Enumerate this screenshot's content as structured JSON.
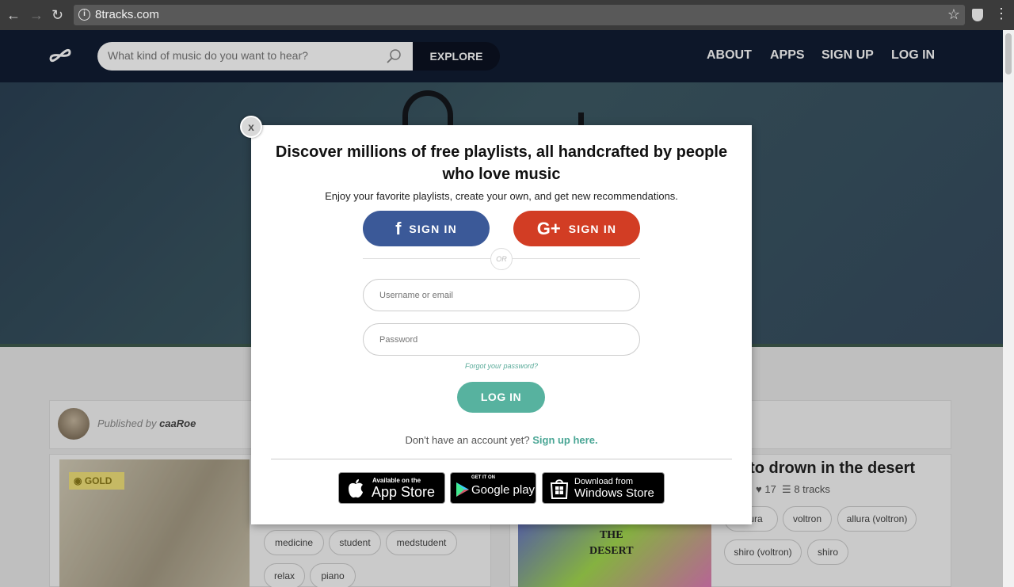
{
  "browser": {
    "url": "8tracks.com",
    "nav_back": "←",
    "nav_forward": "→",
    "nav_reload": "↻",
    "info_glyph": "i",
    "star_glyph": "☆",
    "menu_glyph": "⋮"
  },
  "topnav": {
    "search_placeholder": "What kind of music do you want to hear?",
    "explore_label": "EXPLORE",
    "links": [
      "ABOUT",
      "APPS",
      "SIGN UP",
      "LOG IN"
    ]
  },
  "background": {
    "published_by_prefix": "Published by",
    "publisher": "caaRoe",
    "gold_badge": "GOLD",
    "left_tags": [
      "medicine",
      "student",
      "medstudent",
      "relax",
      "piano"
    ],
    "right_title": "w to drown in the desert",
    "right_likes": "17",
    "right_tracks": "8 tracks",
    "right_tags": [
      "allura",
      "voltron",
      "allura (voltron)",
      "shiro (voltron)",
      "shiro"
    ],
    "art_text": "THE\nDESERT"
  },
  "modal": {
    "close_label": "x",
    "headline": "Discover millions of free playlists, all handcrafted by people who love music",
    "subline": "Enjoy your favorite playlists, create your own, and get new recommendations.",
    "facebook_signin": "SIGN IN",
    "google_signin": "SIGN IN",
    "or_label": "OR",
    "username_placeholder": "Username or email",
    "password_placeholder": "Password",
    "forgot_password": "Forgot your password?",
    "login_button": "LOG IN",
    "no_account": "Don't have an account yet?",
    "signup_link": "Sign up here.",
    "stores": {
      "apple_small": "Available on the",
      "apple_big": "App Store",
      "google_small": "GET IT ON",
      "google_big": "Google play",
      "windows_small": "Download from",
      "windows_big": "Windows Store"
    }
  },
  "colors": {
    "nav_bg": "#111d33",
    "facebook": "#3b5998",
    "google": "#d23d24",
    "teal": "#57b29f"
  }
}
